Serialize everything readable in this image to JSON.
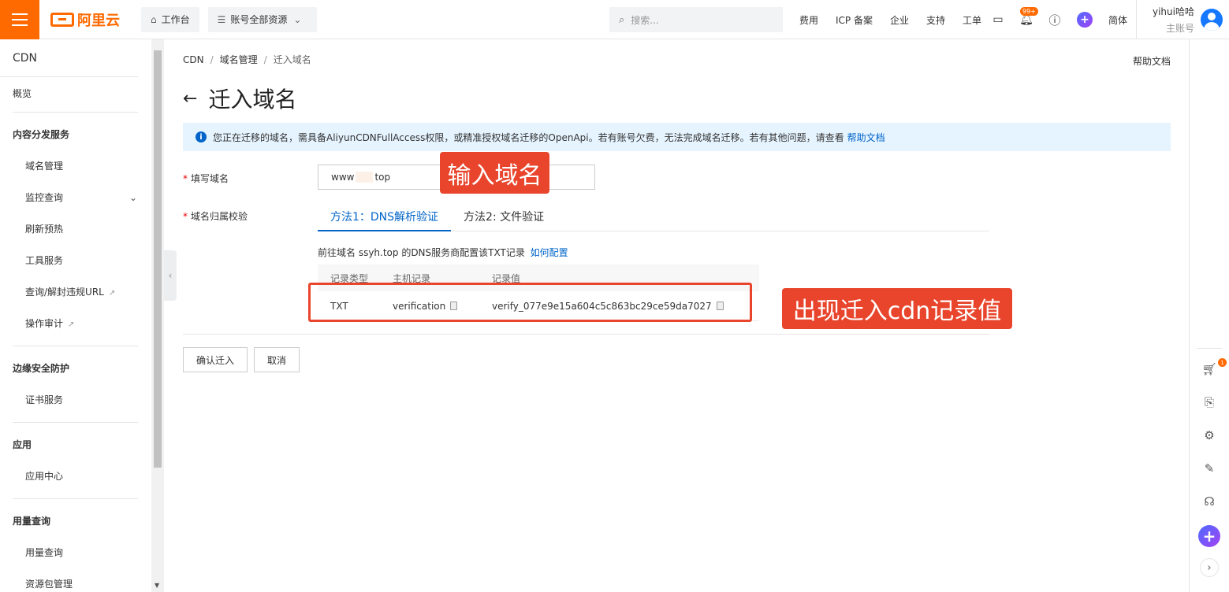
{
  "topbar": {
    "logo_text": "阿里云",
    "workbench": "工作台",
    "resources": "账号全部资源",
    "search_placeholder": "搜索...",
    "links": [
      "费用",
      "ICP 备案",
      "企业",
      "支持",
      "工单"
    ],
    "notification_badge": "99+",
    "lang": "简体",
    "user_name": "yihui哈哈",
    "user_role": "主账号"
  },
  "sidebar": {
    "title": "CDN",
    "overview": "概览",
    "groups": [
      {
        "label": "内容分发服务",
        "items": [
          "域名管理",
          "监控查询",
          "刷新预热",
          "工具服务",
          "查询/解封违规URL",
          "操作审计"
        ]
      },
      {
        "label": "边缘安全防护",
        "items": [
          "证书服务"
        ]
      },
      {
        "label": "应用",
        "items": [
          "应用中心"
        ]
      },
      {
        "label": "用量查询",
        "items": [
          "用量查询",
          "资源包管理"
        ]
      }
    ]
  },
  "breadcrumb": [
    "CDN",
    "域名管理",
    "迁入域名"
  ],
  "help_doc": "帮助文档",
  "page_title": "迁入域名",
  "notice": {
    "text": "您正在迁移的域名，需具备AliyunCDNFullAccess权限，或精准授权域名迁移的OpenApi。若有账号欠费，无法完成域名迁移。若有其他问题，请查看",
    "link": "帮助文档"
  },
  "form": {
    "domain_label": "填写域名",
    "domain_prefix": "www",
    "domain_suffix": "top",
    "verify_label": "域名归属校验",
    "tabs": [
      "方法1：DNS解析验证",
      "方法2: 文件验证"
    ],
    "hint": "前往域名 ssyh.top 的DNS服务商配置该TXT记录",
    "hint_link": "如何配置",
    "table_headers": [
      "记录类型",
      "主机记录",
      "记录值"
    ],
    "record": {
      "type": "TXT",
      "host": "verification",
      "value": "verify_077e9e15a604c5c863bc29ce59da7027"
    },
    "confirm": "确认迁入",
    "cancel": "取消"
  },
  "annotations": {
    "input_domain": "输入域名",
    "record_shown": "出现迁入cdn记录值"
  },
  "rail": {
    "cart_badge": "1"
  },
  "colors": {
    "brand": "#ff6a00",
    "link": "#0064c8",
    "annotation": "#e8452c",
    "notice_bg": "#e6f4ff"
  }
}
